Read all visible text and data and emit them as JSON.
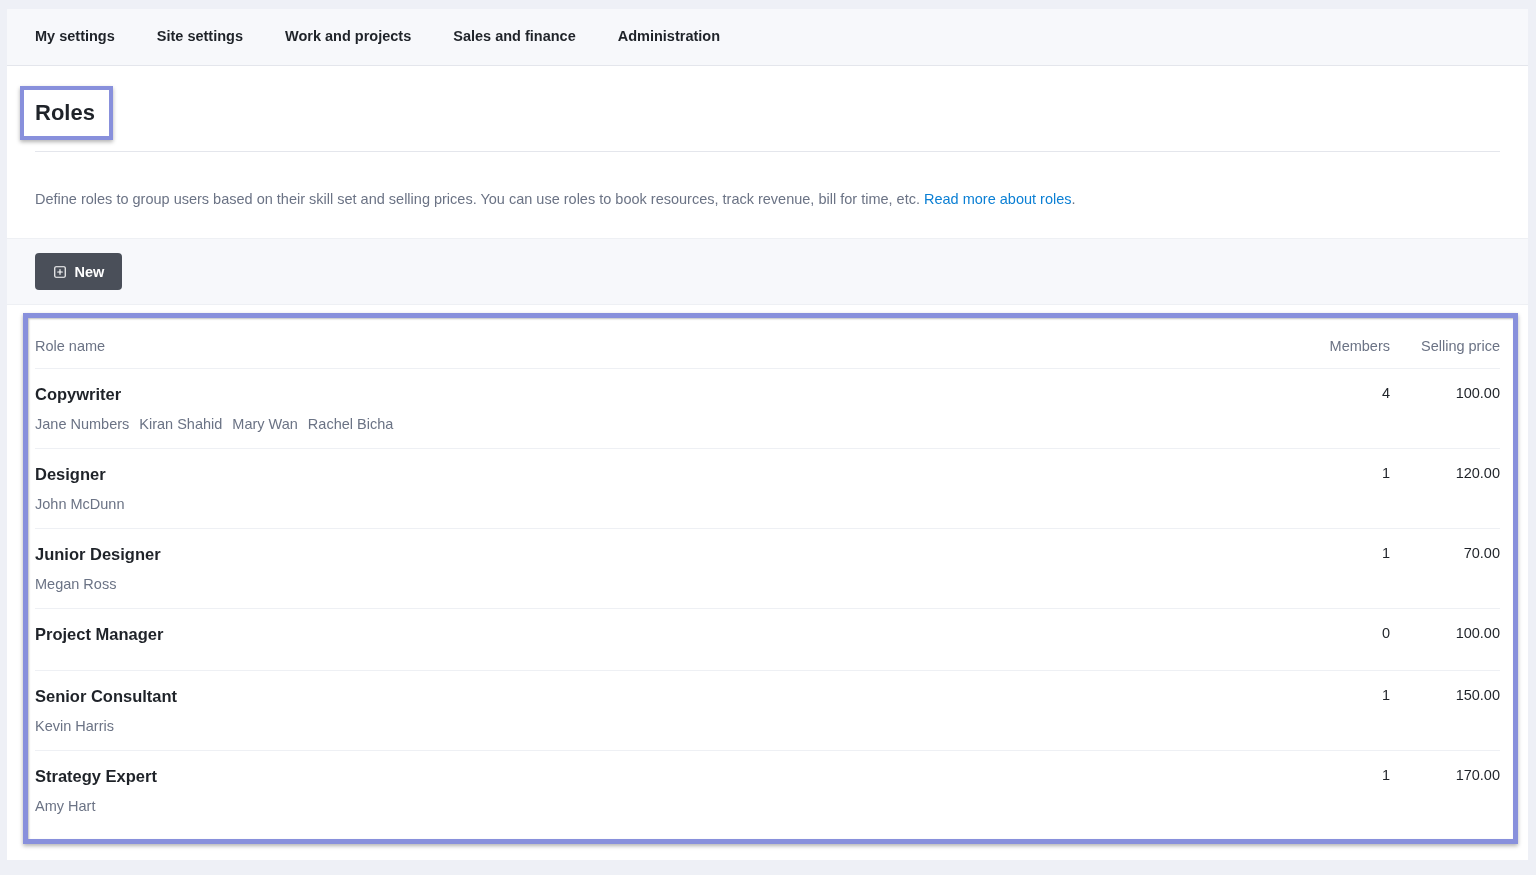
{
  "nav": {
    "tabs": [
      {
        "label": "My settings",
        "selected": false
      },
      {
        "label": "Site settings",
        "selected": false
      },
      {
        "label": "Work and projects",
        "selected": false
      },
      {
        "label": "Sales and finance",
        "selected": false
      },
      {
        "label": "Administration",
        "selected": false
      }
    ]
  },
  "header": {
    "title": "Roles",
    "highlighted": true
  },
  "description": {
    "text": "Define roles to group users based on their skill set and selling prices. You can use roles to book resources, track revenue, bill for time, etc.",
    "link": "Read more about roles",
    "after_link": "."
  },
  "toolbar": {
    "new_button": "New"
  },
  "table": {
    "highlighted": true,
    "columns": [
      "Role name",
      "Members",
      "Selling price"
    ],
    "rows": [
      {
        "name": "Copywriter",
        "members": [
          "Jane Numbers",
          "Kiran Shahid",
          "Mary Wan",
          "Rachel Bicha"
        ],
        "member_count": "4",
        "selling_price": "100.00"
      },
      {
        "name": "Designer",
        "members": [
          "John McDunn"
        ],
        "member_count": "1",
        "selling_price": "120.00"
      },
      {
        "name": "Junior Designer",
        "members": [
          "Megan Ross"
        ],
        "member_count": "1",
        "selling_price": "70.00"
      },
      {
        "name": "Project Manager",
        "members": [],
        "member_count": "0",
        "selling_price": "100.00"
      },
      {
        "name": "Senior Consultant",
        "members": [
          "Kevin Harris"
        ],
        "member_count": "1",
        "selling_price": "150.00"
      },
      {
        "name": "Strategy Expert",
        "members": [
          "Amy Hart"
        ],
        "member_count": "1",
        "selling_price": "170.00"
      }
    ]
  }
}
